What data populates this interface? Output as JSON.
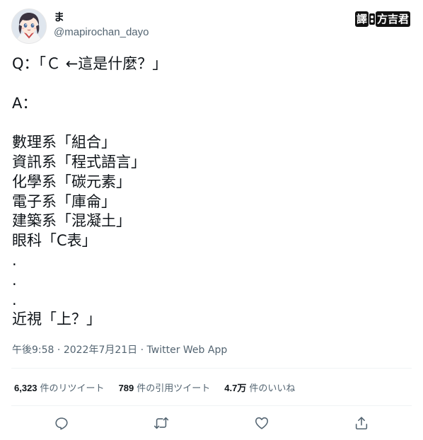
{
  "author": {
    "name": "ま",
    "handle": "@mapirochan_dayo",
    "avatar_icon": "anime-avatar"
  },
  "translator_badge": {
    "prefix": "譯",
    "name": "方吉君"
  },
  "tweet": {
    "lines": [
      "Q：「Ｃ ←這是什麼？」",
      "",
      "A：",
      "",
      "數理系「組合」",
      "資訊系「程式語言」",
      "化學系「碳元素」",
      "電子系「庫侖」",
      "建築系「混凝土」",
      "眼科「C表」",
      ".",
      ".",
      ".",
      "近視「上？」"
    ]
  },
  "meta": {
    "time": "午後9:58",
    "separator1": " · ",
    "date": "2022年7月21日",
    "separator2": " · ",
    "source": "Twitter Web App"
  },
  "stats": {
    "retweets_count": "6,323",
    "retweets_label": "件のリツイート",
    "quotes_count": "789",
    "quotes_label": "件の引用ツイート",
    "likes_count": "4.7万",
    "likes_label": "件のいいね"
  },
  "actions": {
    "reply_icon": "reply-icon",
    "retweet_icon": "retweet-icon",
    "like_icon": "like-icon",
    "share_icon": "share-icon"
  },
  "colors": {
    "text_primary": "#0f1419",
    "text_secondary": "#536471",
    "divider": "#eff3f4"
  }
}
